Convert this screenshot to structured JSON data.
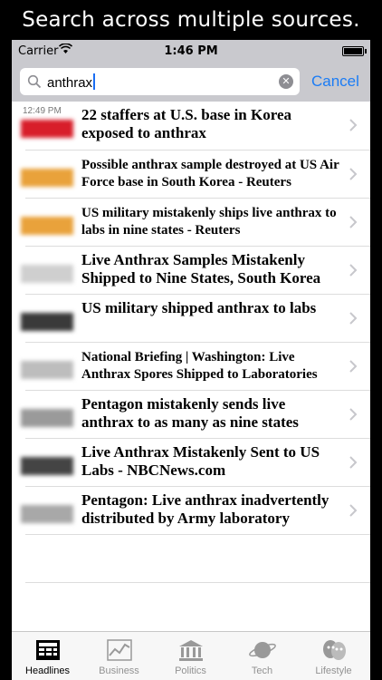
{
  "promo_caption": "Search across multiple sources.",
  "status_bar": {
    "carrier": "Carrier",
    "time": "1:46 PM"
  },
  "search": {
    "query": "anthrax",
    "cancel_label": "Cancel"
  },
  "first_time": "12:49 PM",
  "results": [
    {
      "headline": "22 staffers at U.S. base in Korea exposed to anthrax",
      "logo_color": "#d81e2a"
    },
    {
      "headline": "Possible anthrax sample destroyed at US Air Force base in South Korea - Reuters",
      "logo_color": "#e9a23b"
    },
    {
      "headline": "US military mistakenly ships live anthrax to labs in nine states - Reuters",
      "logo_color": "#e9a23b"
    },
    {
      "headline": "Live Anthrax Samples Mistakenly Shipped to Nine States, South Korea",
      "logo_color": "#cfcfcf"
    },
    {
      "headline": "US military shipped anthrax to labs",
      "logo_color": "#3a3a3a"
    },
    {
      "headline": "National Briefing | Washington: Live Anthrax Spores Shipped to Laboratories",
      "logo_color": "#bdbdbd"
    },
    {
      "headline": "Pentagon mistakenly sends live anthrax to as many as nine states",
      "logo_color": "#9a9a9a"
    },
    {
      "headline": "Live Anthrax Mistakenly Sent to US Labs - NBCNews.com",
      "logo_color": "#444444"
    },
    {
      "headline": "Pentagon: Live anthrax inadvertently distributed by Army laboratory",
      "logo_color": "#a8a8a8"
    }
  ],
  "tabs": [
    {
      "label": "Headlines",
      "icon": "headlines-icon",
      "active": true
    },
    {
      "label": "Business",
      "icon": "business-chart-icon",
      "active": false
    },
    {
      "label": "Politics",
      "icon": "politics-building-icon",
      "active": false
    },
    {
      "label": "Tech",
      "icon": "tech-planet-icon",
      "active": false
    },
    {
      "label": "Lifestyle",
      "icon": "lifestyle-masks-icon",
      "active": false
    }
  ]
}
